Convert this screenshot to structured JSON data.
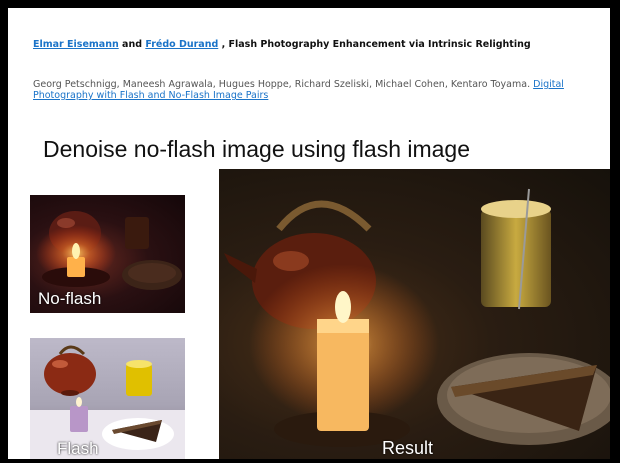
{
  "references": {
    "ref1": {
      "author1": "Elmar Eisemann",
      "and": " and ",
      "author2": "Frédo Durand",
      "title": " , Flash Photography Enhancement via Intrinsic Relighting"
    },
    "ref2": {
      "authors": "Georg Petschnigg, Maneesh Agrawala, Hugues Hoppe, Richard Szeliski, Michael Cohen, Kentaro Toyama. ",
      "link": "Digital Photography with Flash and No-Flash Image Pairs"
    }
  },
  "heading": "Denoise no-flash image using flash image",
  "images": {
    "noflash_label": "No-flash",
    "flash_label": "Flash",
    "result_label": "Result"
  }
}
